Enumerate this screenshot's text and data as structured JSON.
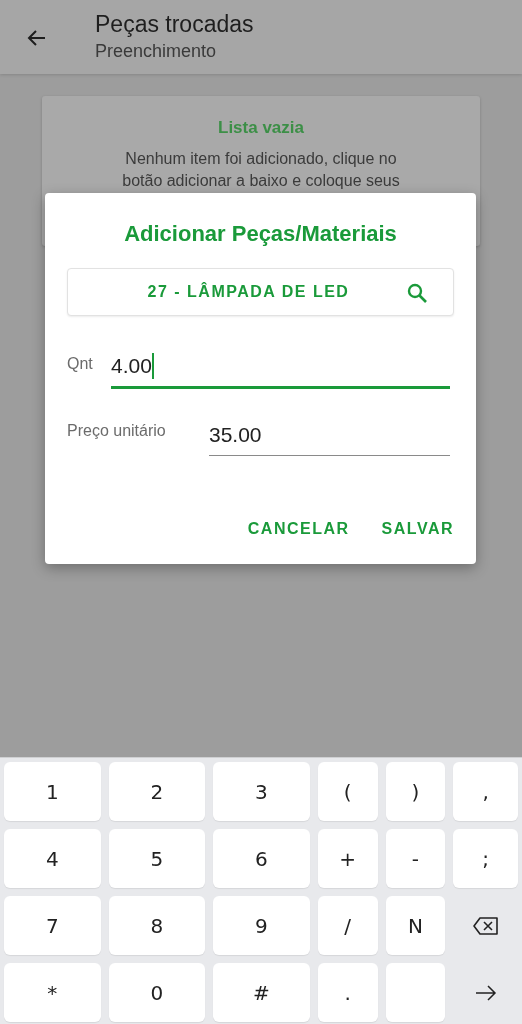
{
  "app_bar": {
    "title": "Peças trocadas",
    "subtitle": "Preenchimento"
  },
  "empty_card": {
    "title": "Lista vazia",
    "message": "Nenhum item foi adicionado, clique no",
    "message_cut": "botão adicionar a baixo e coloque seus"
  },
  "dialog": {
    "title": "Adicionar Peças/Materiais",
    "item": "27 - LÂMPADA DE LED",
    "fields": [
      {
        "label": "Qnt",
        "value": "4.00",
        "focused": true
      },
      {
        "label": "Preço unitário",
        "value": "35.00",
        "focused": false
      }
    ],
    "buttons": [
      "CANCELAR",
      "SALVAR"
    ]
  },
  "keyboard": [
    [
      {
        "kind": "char",
        "label": "1"
      },
      {
        "kind": "char",
        "label": "2"
      },
      {
        "kind": "char",
        "label": "3"
      },
      {
        "kind": "char",
        "label": "("
      },
      {
        "kind": "char",
        "label": ")"
      },
      {
        "kind": "char",
        "label": ","
      }
    ],
    [
      {
        "kind": "char",
        "label": "4"
      },
      {
        "kind": "char",
        "label": "5"
      },
      {
        "kind": "char",
        "label": "6"
      },
      {
        "kind": "char",
        "label": "+"
      },
      {
        "kind": "char",
        "label": "-"
      },
      {
        "kind": "char",
        "label": ";"
      }
    ],
    [
      {
        "kind": "char",
        "label": "7"
      },
      {
        "kind": "char",
        "label": "8"
      },
      {
        "kind": "char",
        "label": "9"
      },
      {
        "kind": "char",
        "label": "/"
      },
      {
        "kind": "char",
        "label": "N"
      },
      {
        "kind": "backspace"
      }
    ],
    [
      {
        "kind": "char",
        "label": "*"
      },
      {
        "kind": "char",
        "label": "0"
      },
      {
        "kind": "char",
        "label": "#"
      },
      {
        "kind": "char",
        "label": "."
      },
      {
        "kind": "blank"
      },
      {
        "kind": "enter"
      }
    ]
  ]
}
